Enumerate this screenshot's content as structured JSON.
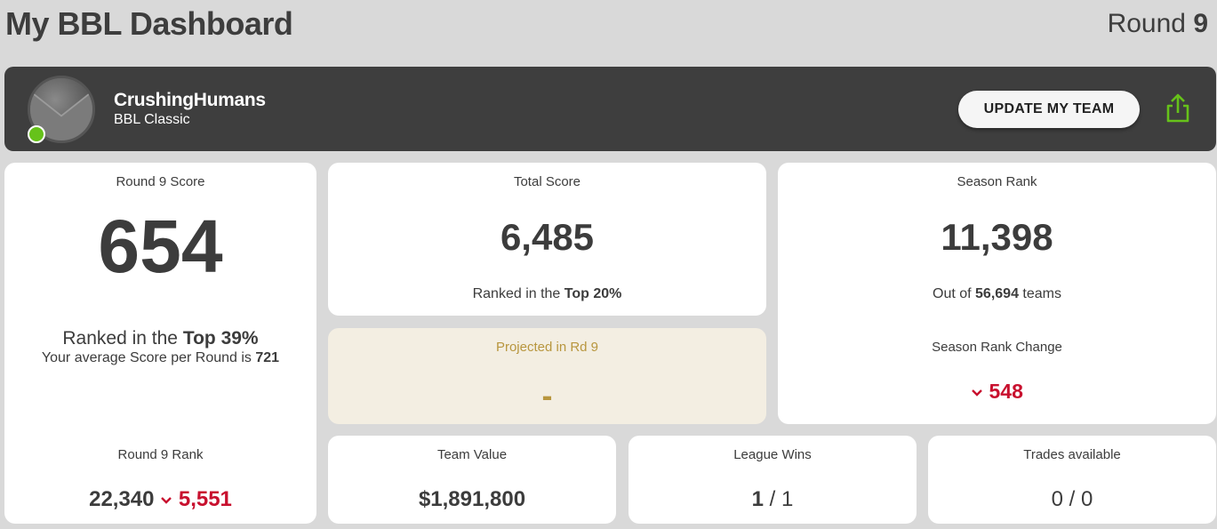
{
  "header": {
    "title": "My BBL Dashboard",
    "round_prefix": "Round",
    "round_number": "9"
  },
  "team": {
    "name": "CrushingHumans",
    "competition": "BBL Classic",
    "avatar_icon": "team-avatar",
    "online_status_color": "#66c21a",
    "update_button": "UPDATE MY TEAM",
    "share_icon": "share-icon",
    "share_icon_color": "#66c21a"
  },
  "round_score": {
    "label": "Round 9 Score",
    "value": "654",
    "ranked_prefix": "Ranked in the ",
    "ranked_value": "Top 39%",
    "average_prefix": "Your average Score per Round is ",
    "average_value": "721"
  },
  "round_rank": {
    "label": "Round 9 Rank",
    "value": "22,340",
    "change_direction": "down",
    "change_value": "5,551"
  },
  "total_score": {
    "label": "Total Score",
    "value": "6,485",
    "ranked_prefix": "Ranked in the ",
    "ranked_value": "Top 20%"
  },
  "projected": {
    "label": "Projected in Rd 9",
    "value": "-",
    "text_color": "#b8963e"
  },
  "season_rank": {
    "label": "Season Rank",
    "value": "11,398",
    "out_of_prefix": "Out of ",
    "out_of_value": "56,694",
    "out_of_suffix": " teams",
    "change_label": "Season Rank Change",
    "change_direction": "down",
    "change_value": "548"
  },
  "team_value": {
    "label": "Team Value",
    "value": "$1,891,800"
  },
  "league_wins": {
    "label": "League Wins",
    "wins": "1",
    "separator": " / ",
    "total": "1"
  },
  "trades": {
    "label": "Trades available",
    "value": "0 / 0"
  },
  "colors": {
    "background": "#d9d9d9",
    "bar": "#3e3e3e",
    "negative_change": "#c8102e"
  }
}
